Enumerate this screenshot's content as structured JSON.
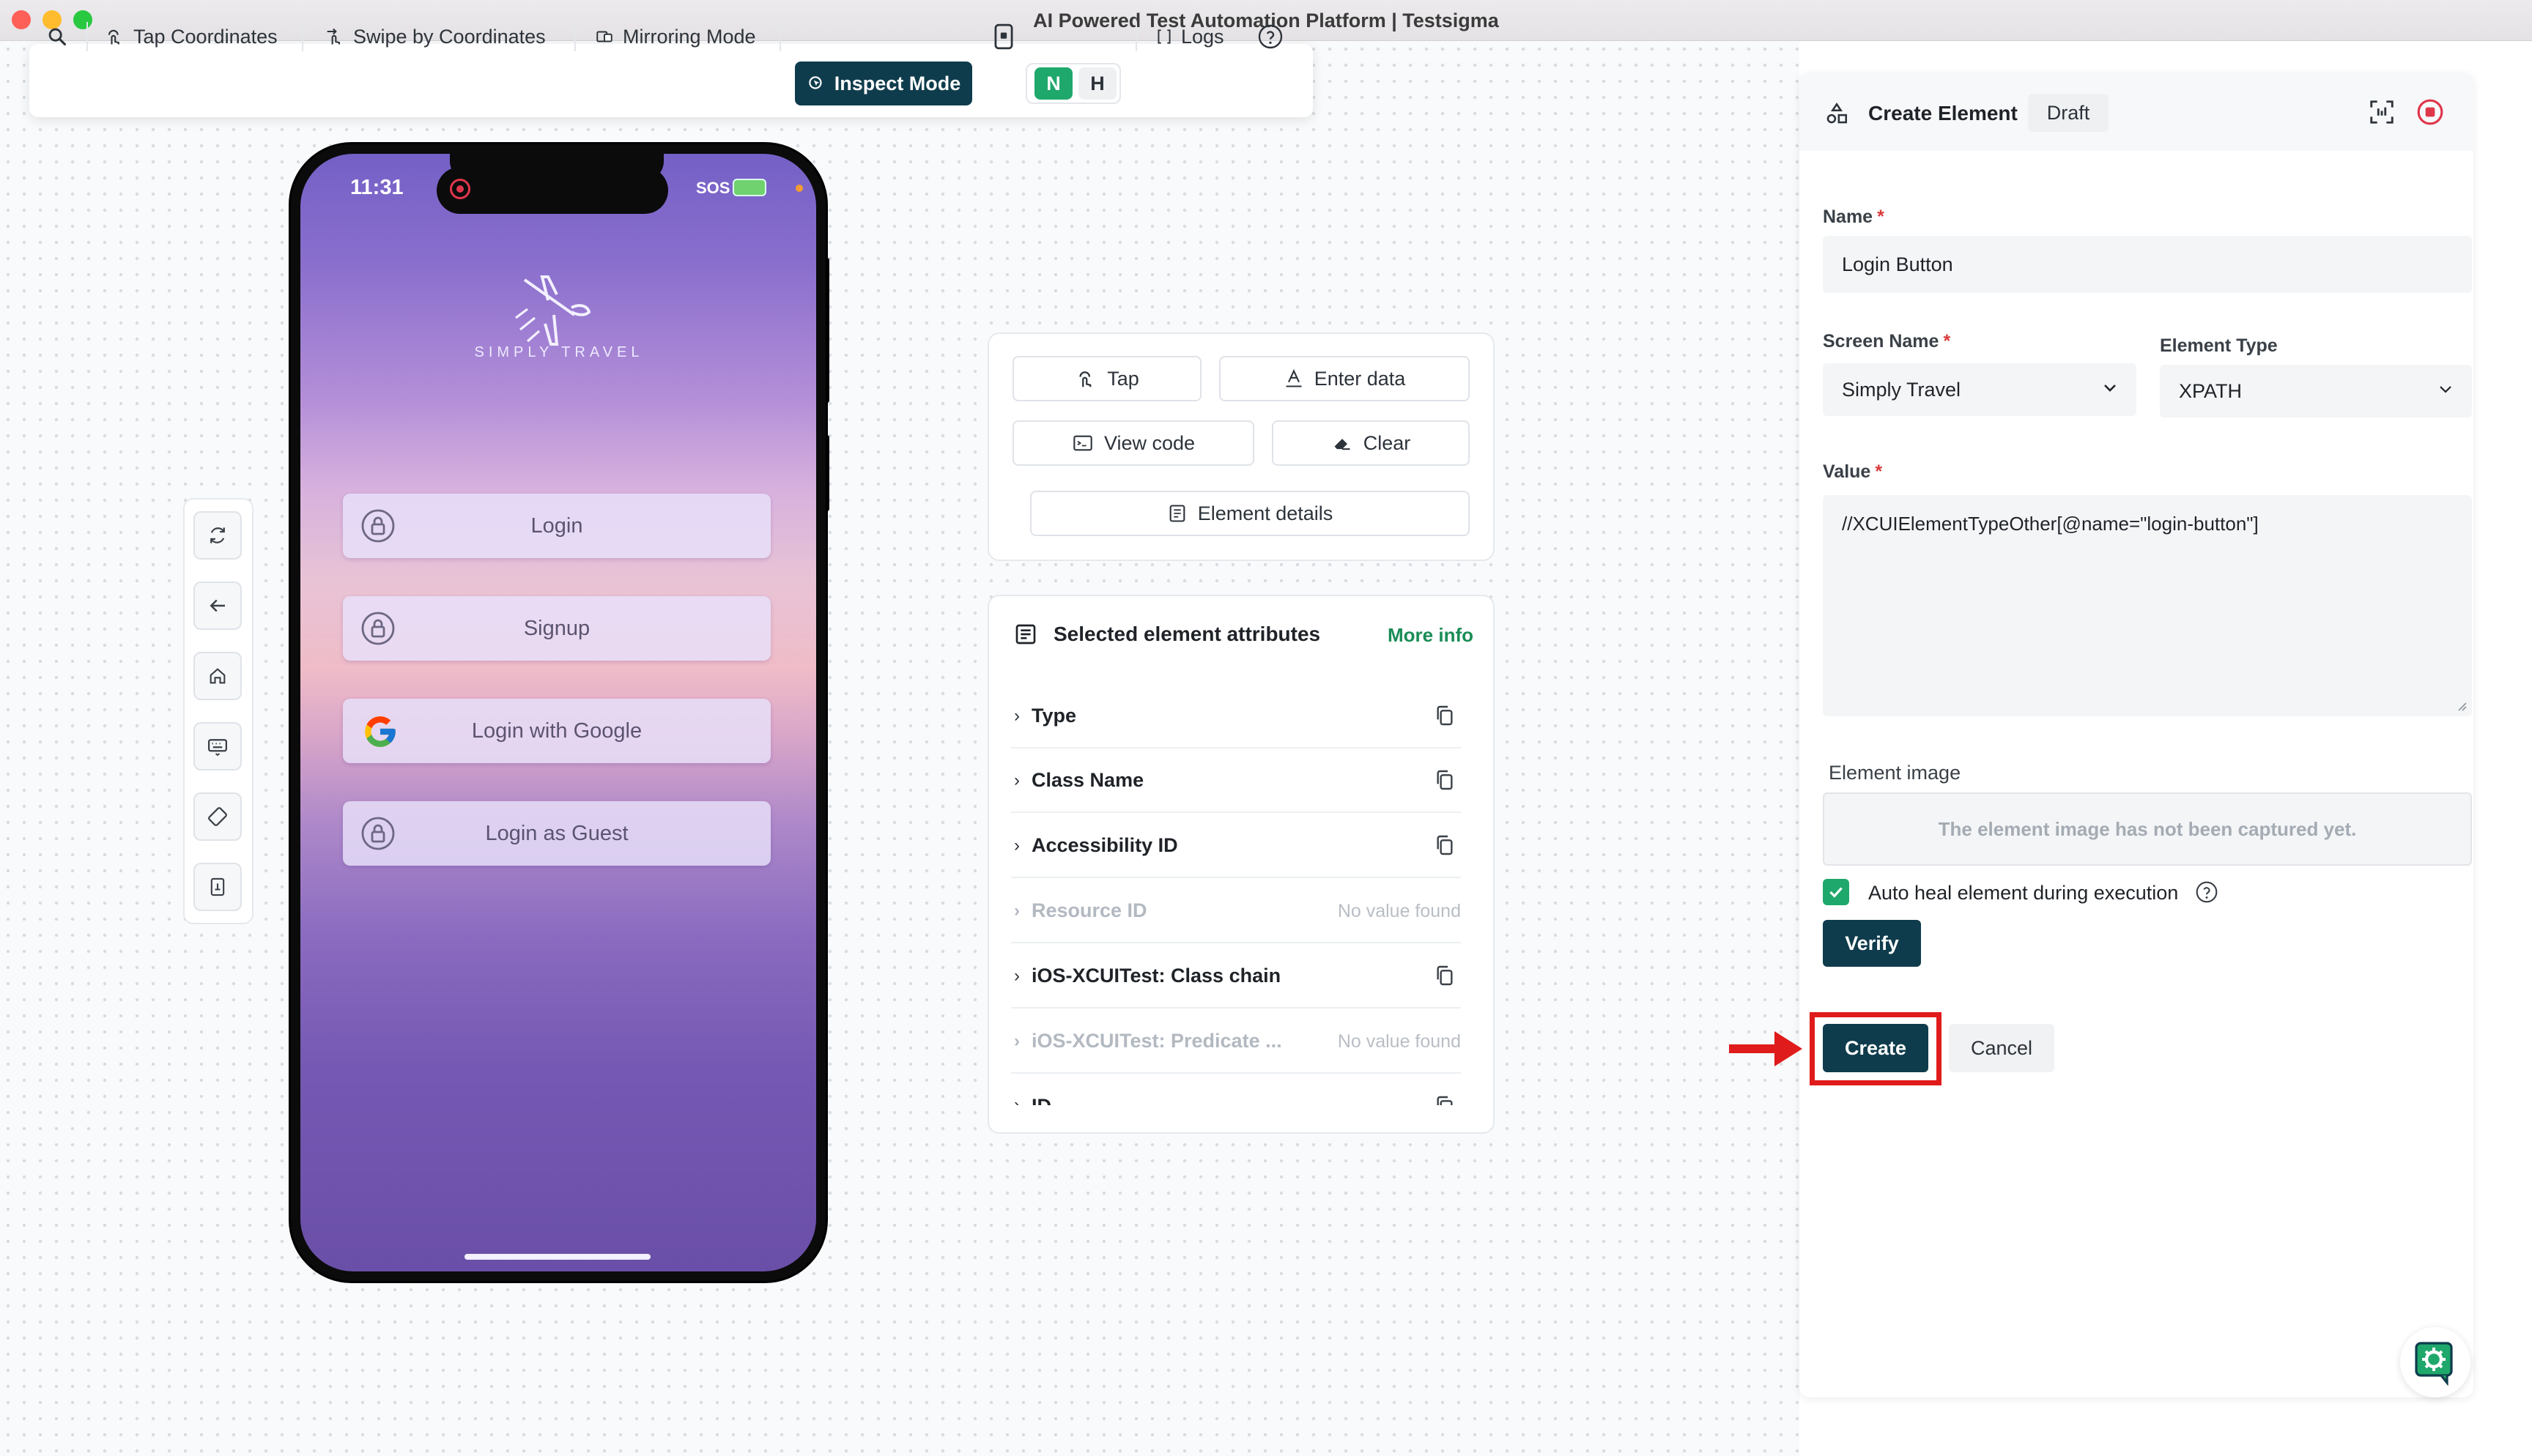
{
  "window": {
    "title": "AI Powered Test Automation Platform | Testsigma"
  },
  "toolbar": {
    "tap_coordinates": "Tap Coordinates",
    "swipe_by_coordinates": "Swipe by Coordinates",
    "mirroring_mode": "Mirroring Mode",
    "inspect_mode": "Inspect Mode",
    "n_label": "N",
    "h_label": "H",
    "logs": "Logs",
    "help": "?"
  },
  "device": {
    "time": "11:31",
    "sos": "SOS",
    "brand": "SIMPLY TRAVEL",
    "buttons": {
      "login": "Login",
      "signup": "Signup",
      "google": "Login with Google",
      "guest": "Login as Guest"
    }
  },
  "actions": {
    "tap": "Tap",
    "enter_data": "Enter data",
    "view_code": "View code",
    "clear": "Clear",
    "element_details": "Element details"
  },
  "attributes": {
    "title": "Selected element attributes",
    "more_info": "More info",
    "no_value": "No value found",
    "rows": {
      "type": "Type",
      "class_name": "Class Name",
      "accessibility_id": "Accessibility ID",
      "resource_id": "Resource ID",
      "class_chain": "iOS-XCUITest: Class chain",
      "predicate": "iOS-XCUITest: Predicate ...",
      "id": "ID"
    }
  },
  "panel": {
    "title": "Create Element",
    "badge": "Draft",
    "name_label": "Name",
    "name_value": "Login Button",
    "screen_name_label": "Screen Name",
    "screen_name_value": "Simply Travel",
    "element_type_label": "Element Type",
    "element_type_value": "XPATH",
    "value_label": "Value",
    "value_text": "//XCUIElementTypeOther[@name=\"login-button\"]",
    "element_image_label": "Element image",
    "element_image_placeholder": "The element image has not been captured yet.",
    "auto_heal_label": "Auto heal element during execution",
    "auto_heal_checked": true,
    "verify": "Verify",
    "create": "Create",
    "cancel": "Cancel",
    "required_mark": "*"
  },
  "colors": {
    "primary_dark": "#0f3c4c",
    "accent_green": "#1fa86b",
    "highlight_red": "#e01b1b"
  }
}
